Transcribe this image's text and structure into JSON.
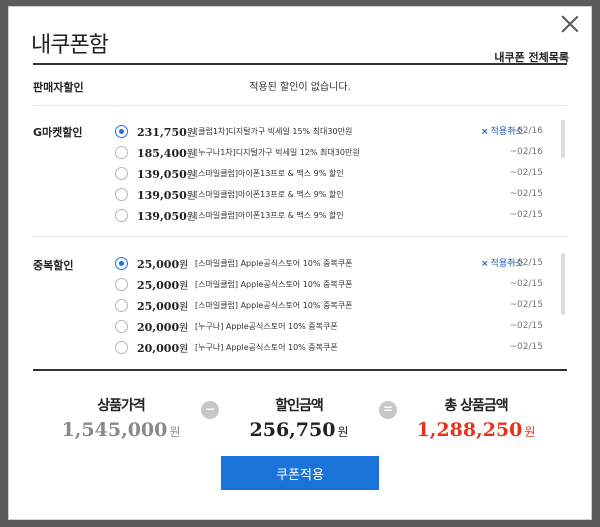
{
  "dialog": {
    "title": "내쿠폰함",
    "my_coupons_all": "내쿠폰 전체목록",
    "close_icon": "close-icon"
  },
  "seller_discount": {
    "label": "판매자할인",
    "empty_message": "적용된 할인이 없습니다."
  },
  "gmarket_discount": {
    "label": "G마켓할인",
    "cancel_label": "적용취소",
    "items": [
      {
        "amount": "231,750",
        "won": "원",
        "desc": "[클럽1차]디지털가구 빅세일 15% 최대30만원",
        "date": "~02/16",
        "selected": true
      },
      {
        "amount": "185,400",
        "won": "원",
        "desc": "[누구나1차]디지털가구 빅세일 12% 최대30만원",
        "date": "~02/16",
        "selected": false
      },
      {
        "amount": "139,050",
        "won": "원",
        "desc": "[스마일클럽]아이폰13프로 & 맥스 9% 할인",
        "date": "~02/15",
        "selected": false
      },
      {
        "amount": "139,050",
        "won": "원",
        "desc": "[스마일클럽]아이폰13프로 & 맥스 9% 할인",
        "date": "~02/15",
        "selected": false
      },
      {
        "amount": "139,050",
        "won": "원",
        "desc": "[스마일클럽]아이폰13프로 & 맥스 9% 할인",
        "date": "~02/15",
        "selected": false
      }
    ]
  },
  "duplicate_discount": {
    "label": "중복할인",
    "cancel_label": "적용취소",
    "items": [
      {
        "amount": "25,000",
        "won": "원",
        "desc": "[스마일클럽] Apple공식스토어 10% 중복쿠폰",
        "date": "~02/15",
        "selected": true
      },
      {
        "amount": "25,000",
        "won": "원",
        "desc": "[스마일클럽] Apple공식스토어 10% 중복쿠폰",
        "date": "~02/15",
        "selected": false
      },
      {
        "amount": "25,000",
        "won": "원",
        "desc": "[스마일클럽] Apple공식스토어 10% 중복쿠폰",
        "date": "~02/15",
        "selected": false
      },
      {
        "amount": "20,000",
        "won": "원",
        "desc": "[누구나] Apple공식스토어 10% 중복쿠폰",
        "date": "~02/15",
        "selected": false
      },
      {
        "amount": "20,000",
        "won": "원",
        "desc": "[누구나] Apple공식스토어 10% 중복쿠폰",
        "date": "~02/15",
        "selected": false
      }
    ]
  },
  "summary": {
    "product_price_label": "상품가격",
    "product_price": "1,545,000",
    "minus_symbol": "−",
    "discount_label": "할인금액",
    "discount_amount": "256,750",
    "equals_symbol": "=",
    "total_label": "총 상품금액",
    "total_amount": "1,288,250",
    "won": "원",
    "colors": {
      "price": "#8a8a8a",
      "discount": "#222222",
      "total": "#e8331c"
    }
  },
  "apply_button": "쿠폰적용",
  "accent_color": "#1a73d9"
}
